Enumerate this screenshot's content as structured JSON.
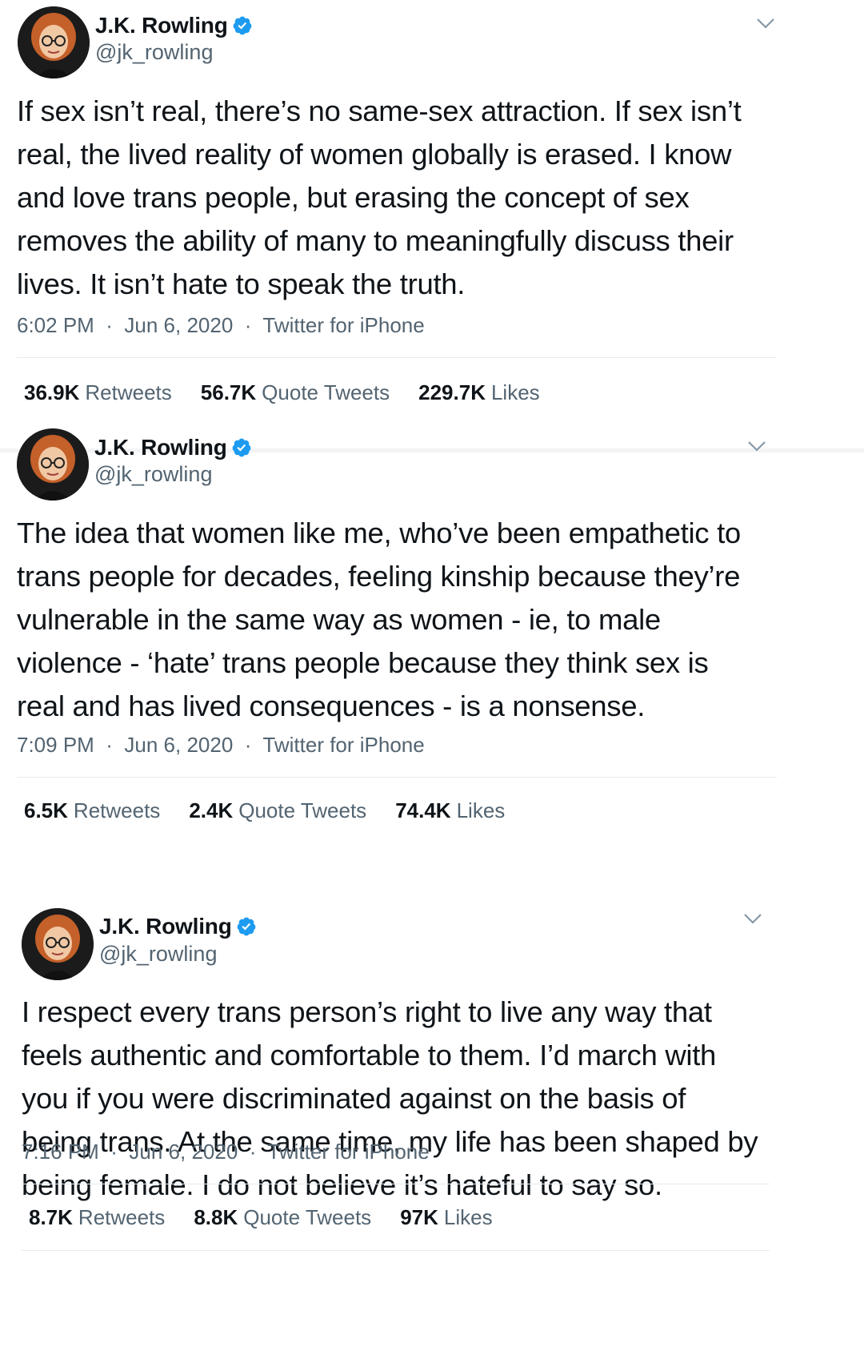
{
  "tweets": [
    {
      "name": "J.K. Rowling",
      "handle": "@jk_rowling",
      "lines": [
        "If sex isn’t real, there’s no same-sex attraction. If sex isn’t",
        "real, the lived reality of women globally is erased. I know",
        "and love trans people, but erasing the concept of sex",
        "removes the ability of many to meaningfully discuss their",
        "lives. It isn’t hate to speak the truth."
      ],
      "time": "6:02 PM",
      "date": "Jun 6, 2020",
      "source": "Twitter for iPhone",
      "retweets": "36.9K",
      "quote_tweets": "56.7K",
      "likes": "229.7K"
    },
    {
      "name": "J.K. Rowling",
      "handle": "@jk_rowling",
      "lines": [
        "The idea that women like me, who’ve been empathetic to",
        "trans people for decades, feeling kinship because they’re",
        "vulnerable in the same way as women - ie, to male",
        "violence - ‘hate’ trans people because they think sex is",
        "real and has lived consequences - is a nonsense."
      ],
      "time": "7:09 PM",
      "date": "Jun 6, 2020",
      "source": "Twitter for iPhone",
      "retweets": "6.5K",
      "quote_tweets": "2.4K",
      "likes": "74.4K"
    },
    {
      "name": "J.K. Rowling",
      "handle": "@jk_rowling",
      "lines": [
        "I respect every trans person’s right to live any way that",
        "feels authentic and comfortable to them. I’d march with",
        "you if you were discriminated against on the basis of",
        "being trans. At the same time, my life has been shaped by",
        "being female. I do not believe it’s hateful to say so."
      ],
      "time": "7:16 PM",
      "date": "Jun 6, 2020",
      "source": "Twitter for iPhone",
      "retweets": "8.7K",
      "quote_tweets": "8.8K",
      "likes": "97K"
    }
  ],
  "labels": {
    "retweets": "Retweets",
    "quote_tweets": "Quote Tweets",
    "likes": "Likes",
    "dot": "·"
  },
  "colors": {
    "verified": "#1d9bf0",
    "secondary_text": "#536471",
    "primary_text": "#0f1419"
  },
  "icons": {
    "verified": "verified-badge-icon",
    "more": "chevron-down-icon"
  }
}
